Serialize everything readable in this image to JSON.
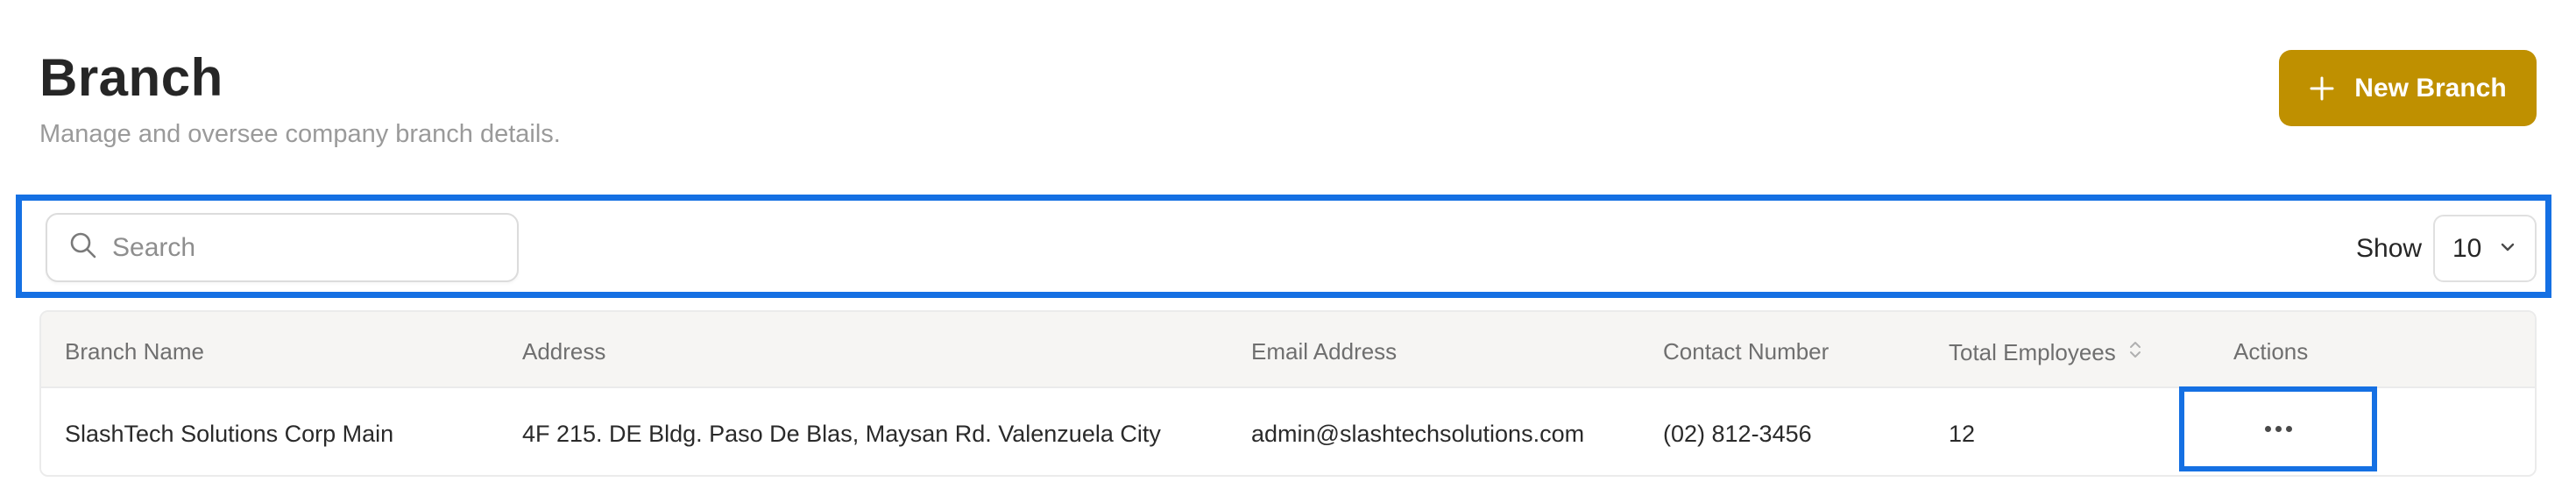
{
  "header": {
    "title": "Branch",
    "subtitle": "Manage and oversee company branch details.",
    "new_button_label": "New Branch",
    "new_button_icon": "plus-icon"
  },
  "toolbar": {
    "search_placeholder": "Search",
    "search_value": "",
    "search_icon": "search-icon",
    "show_label": "Show",
    "page_size": "10",
    "page_size_icon": "chevron-down-icon"
  },
  "table": {
    "columns": [
      "Branch Name",
      "Address",
      "Email Address",
      "Contact Number",
      "Total Employees",
      "Actions"
    ],
    "sort_icon": "sort-icon",
    "rows": [
      {
        "branch_name": "SlashTech Solutions Corp Main",
        "address": "4F 215. DE Bldg. Paso De Blas, Maysan Rd. Valenzuela City",
        "email": "admin@slashtechsolutions.com",
        "contact": "(02) 812-3456",
        "total_employees": "12",
        "actions_icon": "more-horizontal-icon"
      }
    ]
  },
  "colors": {
    "accent": "#bf9000",
    "highlight": "#1570e3",
    "header_bg": "#f6f5f3"
  }
}
